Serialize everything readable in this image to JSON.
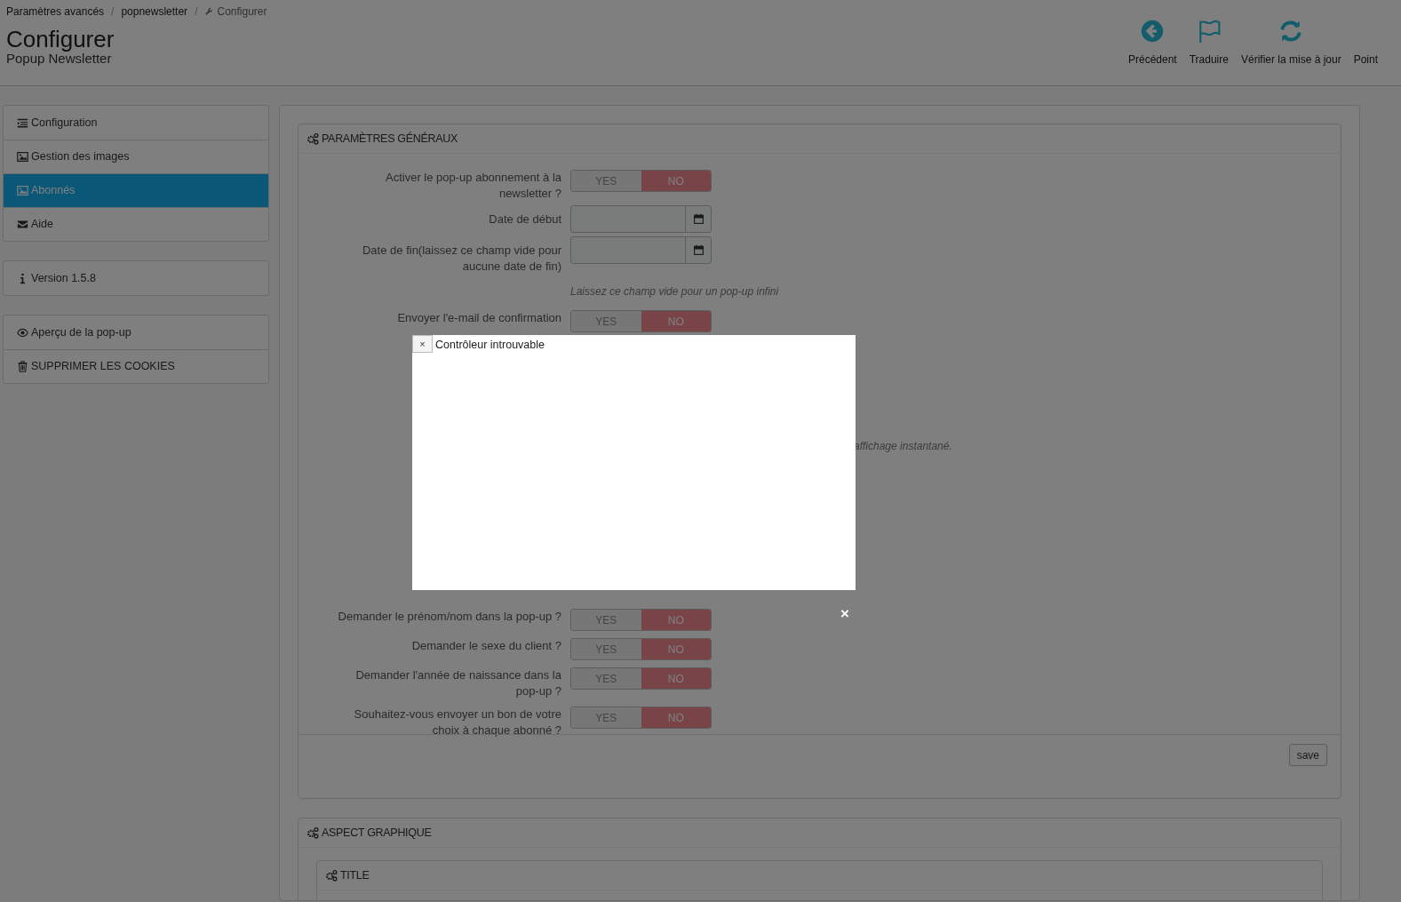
{
  "breadcrumb": [
    {
      "label": "Paramètres avancés",
      "kind": "text"
    },
    {
      "label": "popnewsletter",
      "kind": "text"
    },
    {
      "label": "Configurer",
      "kind": "current"
    }
  ],
  "separator": "/",
  "page_title": "Configurer",
  "page_subtitle": "Popup Newsletter",
  "toolbar": [
    {
      "label": "Précédent"
    },
    {
      "label": "Traduire"
    },
    {
      "label": "Vérifier la mise à jour"
    },
    {
      "label": "Point"
    }
  ],
  "sidebar": [
    [
      {
        "label": "Configuration",
        "selected": false
      },
      {
        "label": "Gestion des images",
        "selected": false
      },
      {
        "label": "Abonnés",
        "selected": true
      },
      {
        "label": "Aide",
        "selected": false
      }
    ],
    [
      {
        "label": "Version 1.5.8",
        "selected": false
      }
    ],
    [
      {
        "label": "Aperçu de la pop-up",
        "selected": false
      },
      {
        "label": "SUPPRIMER LES COOKIES",
        "selected": false
      }
    ]
  ],
  "general_panel": {
    "title": "PARAMÈTRES GÉNÉRAUX",
    "rows": [
      {
        "kind": "switch",
        "label": "Activer le pop-up abonnement à la newsletter ?",
        "yes": "YES",
        "no": "NO",
        "on": false
      },
      {
        "kind": "date",
        "label": "Date de début"
      },
      {
        "kind": "date",
        "label": "Date de fin(laissez ce champ vide pour aucune date de fin)"
      },
      {
        "kind": "hint",
        "text": "Laissez ce champ vide pour un pop-up infini"
      },
      {
        "kind": "switch",
        "label": "Envoyer l'e-mail de confirmation",
        "yes": "YES",
        "no": "NO",
        "on": false
      },
      {
        "kind": "hidden",
        "text": "affichage instantané."
      },
      {
        "kind": "switch",
        "label": "Demander le prénom/nom dans la pop-up ?",
        "yes": "YES",
        "no": "NO",
        "on": false
      },
      {
        "kind": "switch",
        "label": "Demander le sexe du client ?",
        "yes": "YES",
        "no": "NO",
        "on": false
      },
      {
        "kind": "switch",
        "label": "Demander l'année de naissance dans la pop-up ?",
        "yes": "YES",
        "no": "NO",
        "on": false
      },
      {
        "kind": "switch",
        "label": "Souhaitez-vous envoyer un bon de votre choix à chaque abonné ?",
        "yes": "YES",
        "no": "NO",
        "on": false
      }
    ],
    "save": "save"
  },
  "graphic_panel": {
    "title": "ASPECT GRAPHIQUE",
    "subpanel_title": "TITLE"
  },
  "modal": {
    "close": "×",
    "title": "Contrôleur introuvable",
    "outer_close": "×"
  }
}
